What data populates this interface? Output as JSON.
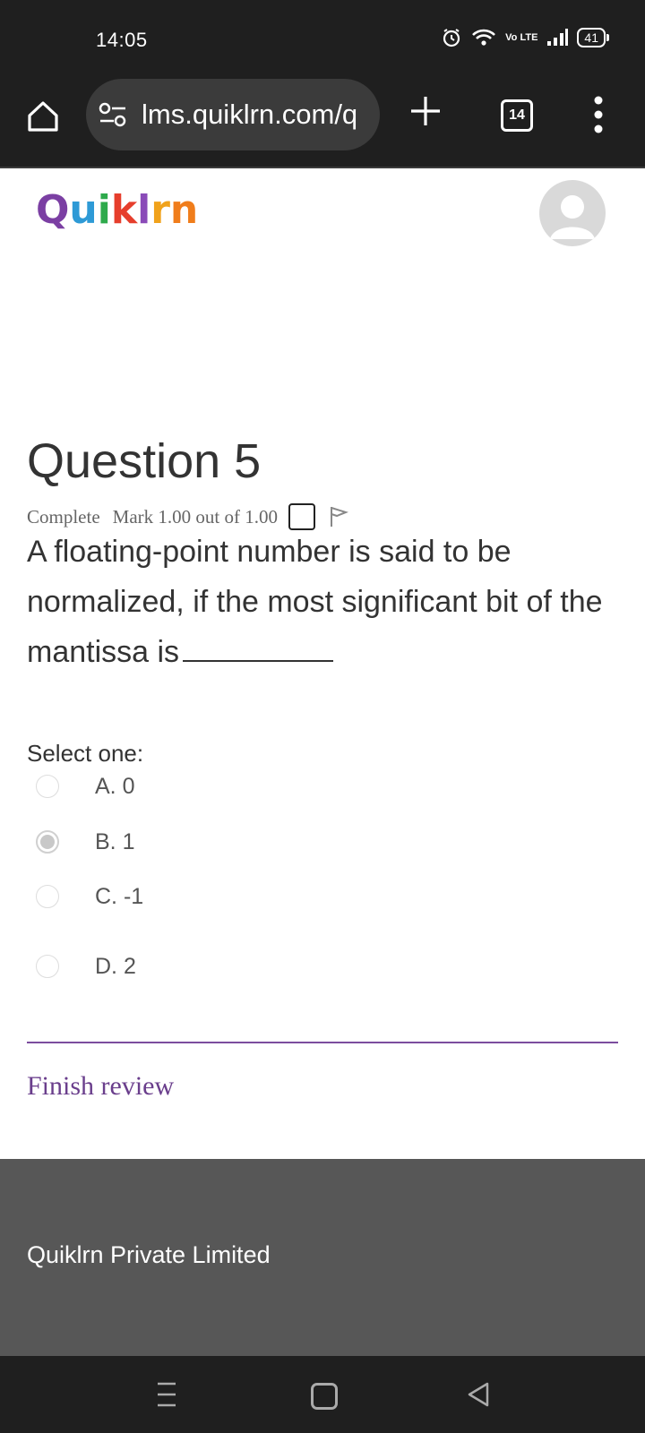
{
  "status_bar": {
    "time": "14:05",
    "network_label": "Vo LTE",
    "battery": "41",
    "icons": [
      "alarm-icon",
      "wifi-icon",
      "signal-icon",
      "battery-icon"
    ]
  },
  "browser": {
    "url": "lms.quiklrn.com/q",
    "tab_count": "14",
    "icons": [
      "home-icon",
      "site-settings-icon",
      "new-tab-icon",
      "tab-switcher-icon",
      "menu-icon"
    ]
  },
  "site": {
    "logo_letters": [
      "Q",
      "u",
      "i",
      "k",
      "l",
      "r",
      "n"
    ],
    "logo_colors": [
      "#7b3fa3",
      "#2e9ad6",
      "#2eaa4c",
      "#e63e2c",
      "#8a4bb8",
      "#f0a21b",
      "#f07d1b"
    ]
  },
  "question": {
    "title": "Question 5",
    "state": "Complete",
    "mark": "Mark 1.00 out of 1.00",
    "text": "A floating-point number is said to be normalized, if the most significant bit of the mantissa is",
    "select_label": "Select one:",
    "answers": [
      {
        "label": "A. 0",
        "selected": false
      },
      {
        "label": "B. 1",
        "selected": true
      },
      {
        "label": "C. -1",
        "selected": false
      },
      {
        "label": "D. 2",
        "selected": false
      }
    ]
  },
  "actions": {
    "finish_review": "Finish review"
  },
  "footer": {
    "company": "Quiklrn Private Limited"
  },
  "colors": {
    "accent": "#6a3e8c",
    "footer_bg": "#575757",
    "chrome_bg": "#1f1f1f"
  }
}
